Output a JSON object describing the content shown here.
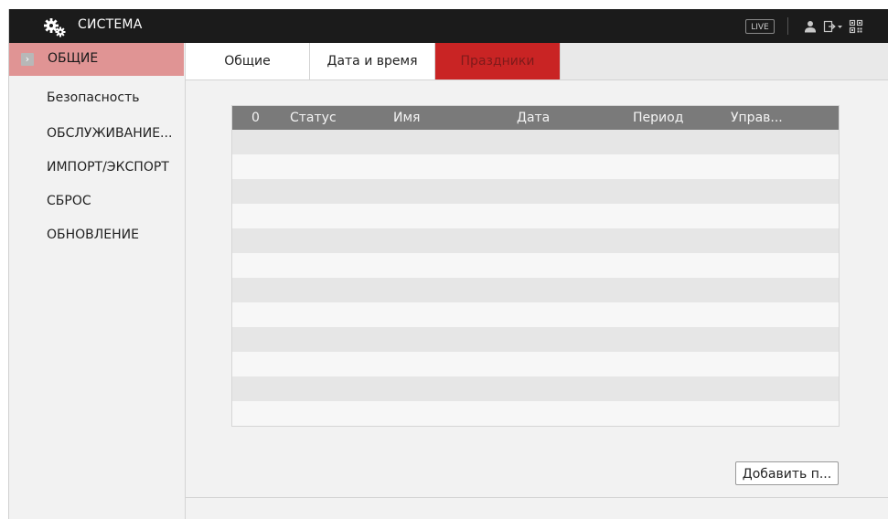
{
  "app": {
    "title": "СИСТЕМА",
    "live_label": "LIVE",
    "icons": [
      "gears-icon",
      "user-icon",
      "logout-icon",
      "qr-icon"
    ]
  },
  "sidebar": {
    "items": [
      {
        "label": "ОБЩИЕ",
        "active": true
      },
      {
        "label": "Безопасность",
        "active": false
      },
      {
        "label": "ОБСЛУЖИВАНИЕ...",
        "active": false
      },
      {
        "label": "ИМПОРТ/ЭКСПОРТ",
        "active": false
      },
      {
        "label": "СБРОС",
        "active": false
      },
      {
        "label": "ОБНОВЛЕНИЕ",
        "active": false
      }
    ]
  },
  "tabs": [
    {
      "label": "Общие",
      "active": false
    },
    {
      "label": "Дата и время",
      "active": false
    },
    {
      "label": "Праздники",
      "active": true
    }
  ],
  "table": {
    "columns": [
      "0",
      "Статус",
      "Имя",
      "Дата",
      "Период",
      "Управ..."
    ],
    "rows": []
  },
  "actions": {
    "add_label": "Добавить п..."
  },
  "colors": {
    "topbar": "#1b1b1b",
    "active_sidebar": "#e09494",
    "active_tab": "#c92424",
    "table_header": "#7a7a7a"
  }
}
